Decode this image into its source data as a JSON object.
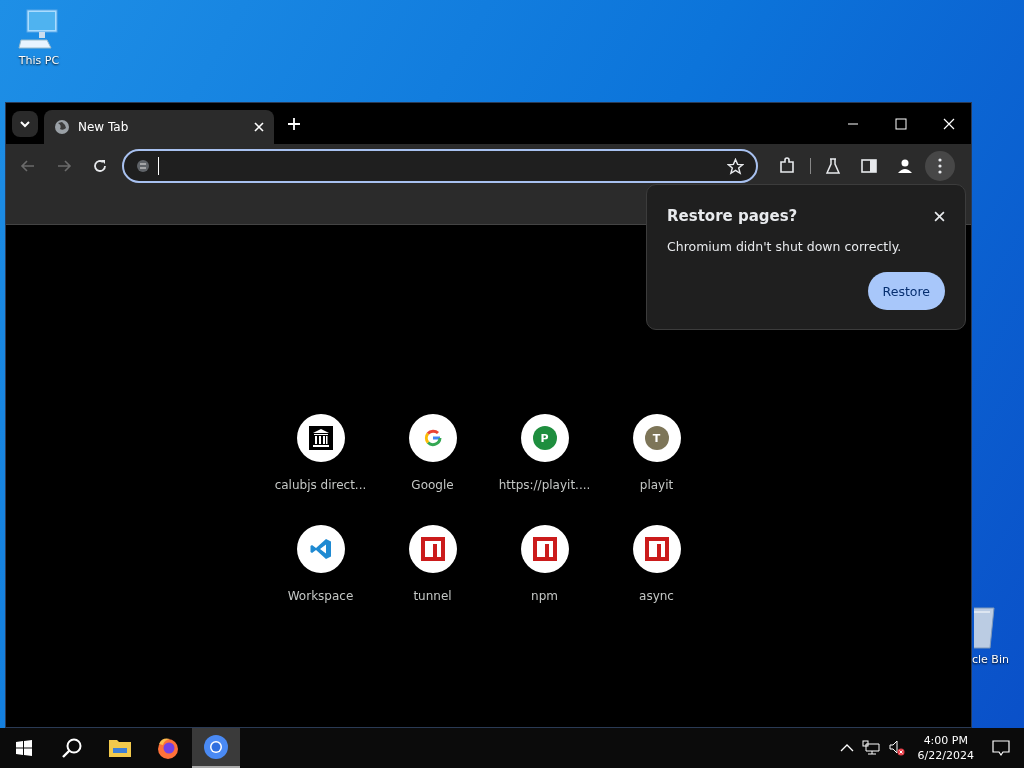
{
  "desktop": {
    "icons": [
      {
        "label": "This PC",
        "kind": "pc"
      }
    ],
    "partial_icon": {
      "label": "cle Bin",
      "kind": "bin"
    }
  },
  "browser": {
    "tabs": [
      {
        "title": "New Tab",
        "selected": true
      }
    ],
    "toolbar": {
      "back": {
        "disabled": true
      },
      "forward": {
        "disabled": true
      },
      "omnibox": {
        "focused": true
      },
      "menu_highlighted": true
    },
    "shortcuts": [
      {
        "label": "calubjs direct...",
        "kind": "building"
      },
      {
        "label": "Google",
        "kind": "google"
      },
      {
        "label": "https://playit....",
        "kind": "letter",
        "letter": "P",
        "color": "#1e8e3e"
      },
      {
        "label": "playit",
        "kind": "letter",
        "letter": "T",
        "color": "#7d7558"
      },
      {
        "label": "Workspace",
        "kind": "vscode"
      },
      {
        "label": "tunnel",
        "kind": "npm"
      },
      {
        "label": "npm",
        "kind": "npm"
      },
      {
        "label": "async",
        "kind": "npm"
      }
    ],
    "popup": {
      "title": "Restore pages?",
      "message": "Chromium didn't shut down correctly.",
      "button": "Restore"
    }
  },
  "taskbar": {
    "apps": [
      {
        "kind": "start",
        "selected": false
      },
      {
        "kind": "search",
        "selected": false
      },
      {
        "kind": "explorer",
        "selected": false
      },
      {
        "kind": "firefox",
        "selected": false
      },
      {
        "kind": "chromium",
        "selected": true
      }
    ],
    "tray": {
      "volume_muted": true,
      "time": "4:00 PM",
      "date": "6/22/2024"
    }
  }
}
